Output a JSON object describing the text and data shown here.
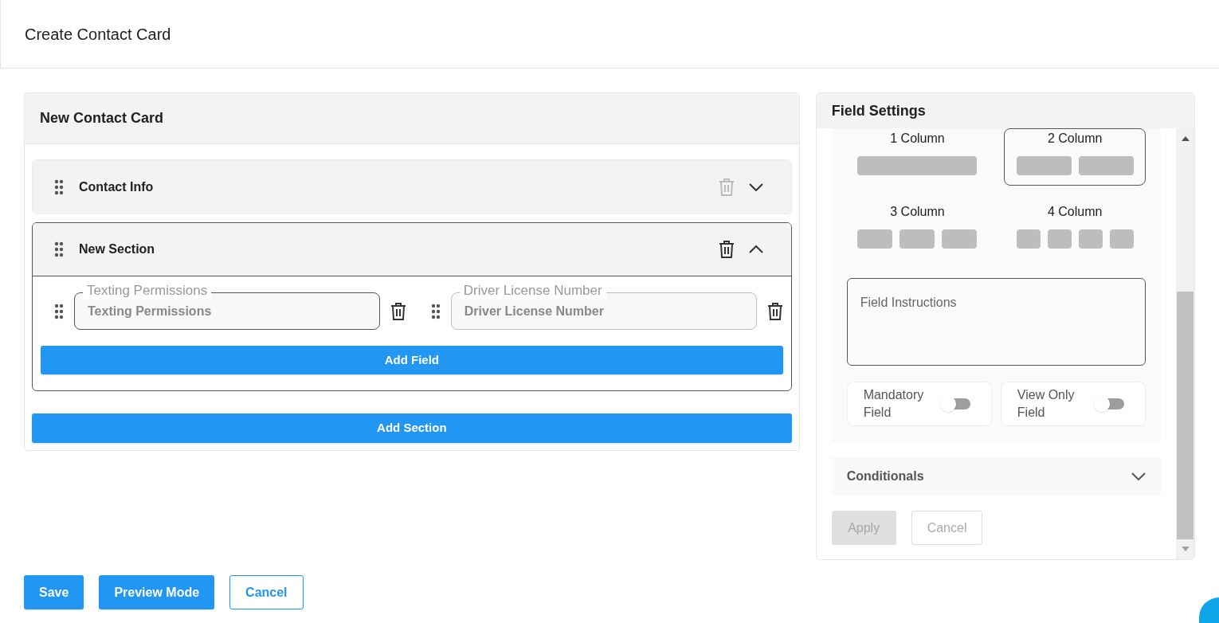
{
  "page": {
    "title": "Create Contact Card"
  },
  "card": {
    "title": "New Contact Card",
    "sections": [
      {
        "title": "Contact Info",
        "expanded": false,
        "delete_disabled": true
      },
      {
        "title": "New Section",
        "expanded": true,
        "delete_disabled": false,
        "fields": [
          {
            "label": "Texting Permissions",
            "placeholder": "Texting Permissions",
            "focused": true
          },
          {
            "label": "Driver License Number",
            "placeholder": "Driver License Number",
            "focused": false
          }
        ],
        "add_field": "Add Field"
      }
    ],
    "add_section": "Add Section"
  },
  "settings": {
    "title": "Field Settings",
    "layouts": [
      {
        "label": "1 Column",
        "selected": false
      },
      {
        "label": "2 Column",
        "selected": true
      },
      {
        "label": "3 Column",
        "selected": false
      },
      {
        "label": "4 Column",
        "selected": false
      }
    ],
    "instructions": {
      "placeholder": "Field Instructions"
    },
    "toggles": [
      {
        "label": "Mandatory Field",
        "on": false
      },
      {
        "label": "View Only Field",
        "on": false
      }
    ],
    "conditionals": {
      "title": "Conditionals",
      "expanded": false
    },
    "buttons": [
      {
        "label": "Apply",
        "kind": "primary",
        "disabled": true
      },
      {
        "label": "Cancel",
        "kind": "outline",
        "disabled": true
      }
    ]
  },
  "footer": [
    {
      "label": "Save",
      "kind": "primary"
    },
    {
      "label": "Preview Mode",
      "kind": "primary"
    },
    {
      "label": "Cancel",
      "kind": "outline"
    }
  ]
}
